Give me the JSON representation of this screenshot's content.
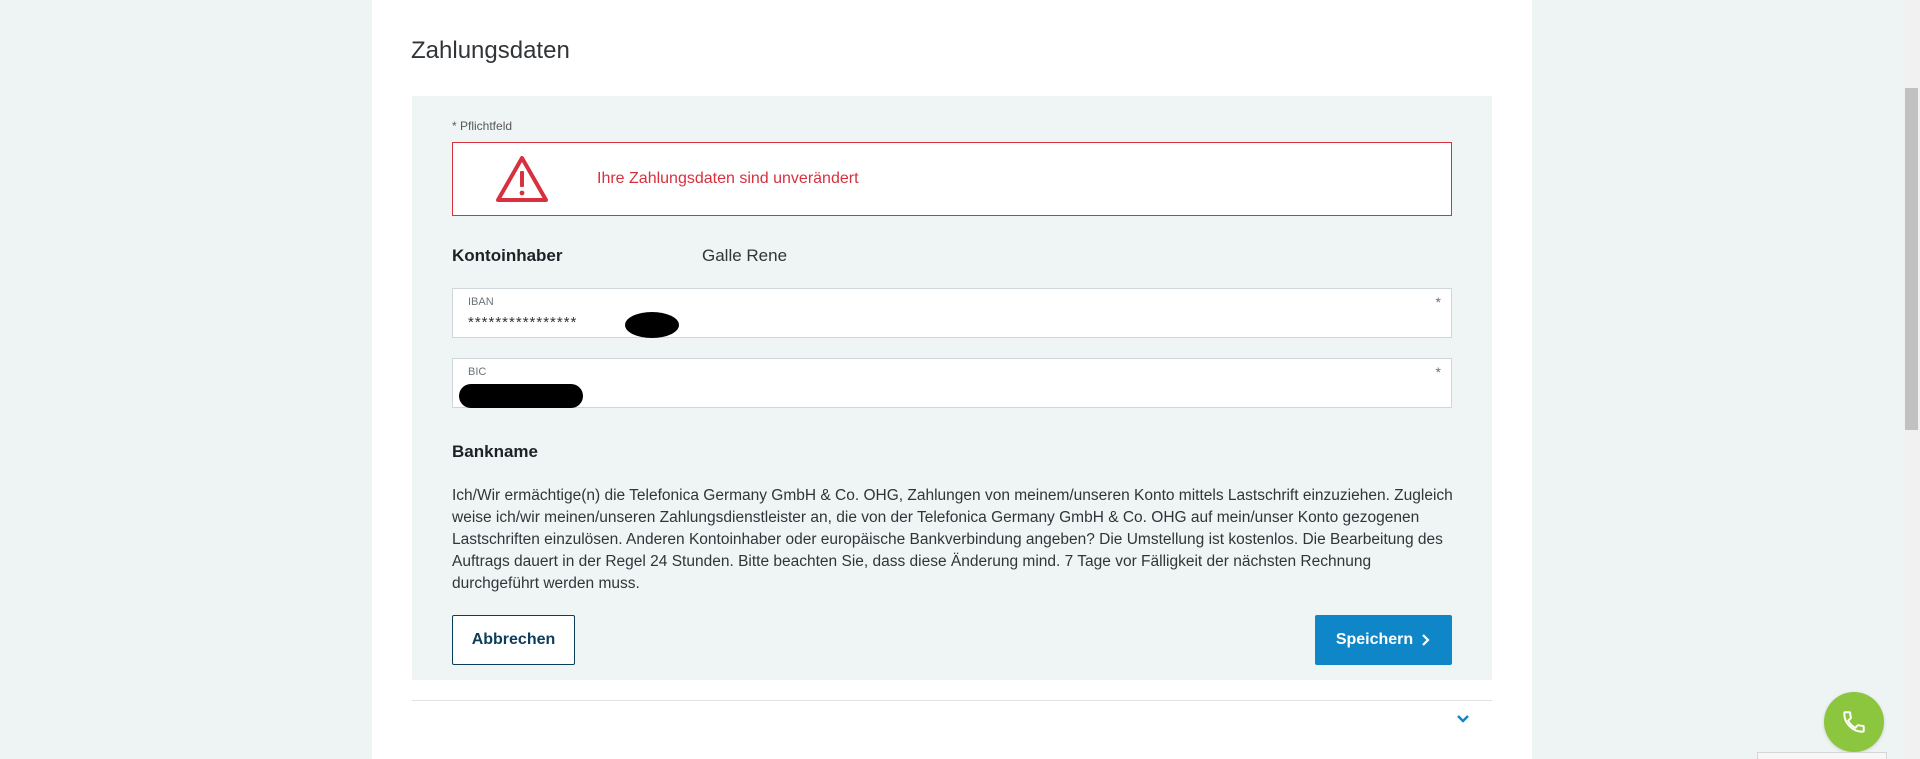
{
  "section": {
    "title": "Zahlungsdaten"
  },
  "form": {
    "required_note": "* Pflichtfeld",
    "alert": {
      "message": "Ihre Zahlungsdaten sind unverändert",
      "icon": "warning-triangle-icon",
      "color": "#d7303e"
    },
    "account_holder": {
      "label": "Kontoinhaber",
      "value": "Galle Rene"
    },
    "iban": {
      "label": "IBAN",
      "required_marker": "*",
      "value": "****************"
    },
    "bic": {
      "label": "BIC",
      "required_marker": "*",
      "value": ""
    },
    "bank_name_label": "Bankname",
    "mandate_text": "Ich/Wir ermächtige(n) die Telefonica Germany GmbH & Co. OHG, Zahlungen von meinem/unseren Konto mittels Lastschrift einzuziehen. Zugleich weise ich/wir meinen/unseren Zahlungsdienstleister an, die von der Telefonica Germany GmbH & Co. OHG auf mein/unser Konto gezogenen Lastschriften einzulösen. Anderen Kontoinhaber oder europäische Bankverbindung angeben?   Die Umstellung ist kostenlos. Die Bearbeitung des Auftrags dauert in der Regel 24 Stunden. Bitte beachten Sie, dass diese Änderung mind. 7 Tage vor Fälligkeit der nächsten Rechnung durchgeführt werden muss.",
    "buttons": {
      "cancel": "Abbrechen",
      "save": "Speichern"
    }
  },
  "icons": {
    "expand": "chevron-down-icon",
    "save_arrow": "chevron-right-icon",
    "call": "phone-icon"
  },
  "colors": {
    "primary": "#0f86c8",
    "dark_blue": "#0c3d5a",
    "error": "#d7303e",
    "call_button": "#8cc63f"
  }
}
